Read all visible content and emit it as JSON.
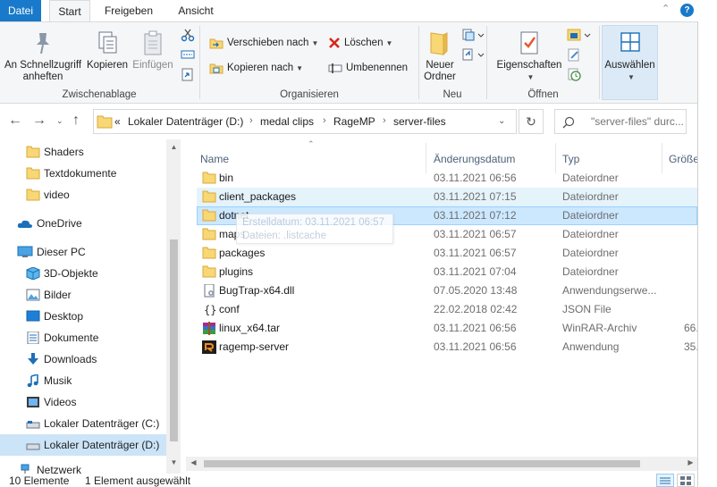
{
  "ribbon_tabs": {
    "file": "Datei",
    "start": "Start",
    "share": "Freigeben",
    "view": "Ansicht"
  },
  "help_label": "?",
  "clipboard": {
    "pin_label_1": "An Schnellzugriff",
    "pin_label_2": "anheften",
    "copy_label": "Kopieren",
    "paste_label": "Einfügen",
    "group_label": "Zwischenablage"
  },
  "organize": {
    "move_label": "Verschieben nach",
    "copy_to_label": "Kopieren nach",
    "delete_label": "Löschen",
    "rename_label": "Umbenennen",
    "group_label": "Organisieren"
  },
  "new": {
    "new_folder_label_1": "Neuer",
    "new_folder_label_2": "Ordner",
    "group_label": "Neu"
  },
  "open": {
    "properties_label": "Eigenschaften",
    "group_label": "Öffnen"
  },
  "select": {
    "select_label": "Auswählen"
  },
  "address": {
    "overflow": "«",
    "crumbs": [
      "Lokaler Datenträger (D:)",
      "medal clips",
      "RageMP",
      "server-files"
    ]
  },
  "search": {
    "placeholder": "\"server-files\" durc..."
  },
  "navigation": [
    {
      "label": "Shaders",
      "icon": "folder-icon"
    },
    {
      "label": "Textdokumente",
      "icon": "folder-icon"
    },
    {
      "label": "video",
      "icon": "folder-icon"
    },
    {
      "label": "OneDrive",
      "icon": "cloud-icon"
    },
    {
      "label": "Dieser PC",
      "icon": "computer-icon"
    },
    {
      "label": "3D-Objekte",
      "icon": "cube-icon"
    },
    {
      "label": "Bilder",
      "icon": "pictures-icon"
    },
    {
      "label": "Desktop",
      "icon": "desktop-icon"
    },
    {
      "label": "Dokumente",
      "icon": "documents-icon"
    },
    {
      "label": "Downloads",
      "icon": "download-icon"
    },
    {
      "label": "Musik",
      "icon": "music-icon"
    },
    {
      "label": "Videos",
      "icon": "videos-icon"
    },
    {
      "label": "Lokaler Datenträger (C:)",
      "icon": "drive-icon"
    },
    {
      "label": "Lokaler Datenträger (D:)",
      "icon": "drive-icon"
    },
    {
      "label": "Netzwerk",
      "icon": "network-icon"
    }
  ],
  "columns": {
    "name": "Name",
    "date": "Änderungsdatum",
    "type": "Typ",
    "size": "Größe"
  },
  "files": [
    {
      "name": "bin",
      "date": "03.11.2021 06:56",
      "type": "Dateiordner",
      "size": "",
      "icon": "folder-icon"
    },
    {
      "name": "client_packages",
      "date": "03.11.2021 07:15",
      "type": "Dateiordner",
      "size": "",
      "icon": "folder-icon"
    },
    {
      "name": "dotnet",
      "date": "03.11.2021 07:12",
      "type": "Dateiordner",
      "size": "",
      "icon": "folder-icon"
    },
    {
      "name": "maps",
      "date": "03.11.2021 06:57",
      "type": "Dateiordner",
      "size": "",
      "icon": "folder-icon"
    },
    {
      "name": "packages",
      "date": "03.11.2021 06:57",
      "type": "Dateiordner",
      "size": "",
      "icon": "folder-icon"
    },
    {
      "name": "plugins",
      "date": "03.11.2021 07:04",
      "type": "Dateiordner",
      "size": "",
      "icon": "folder-icon"
    },
    {
      "name": "BugTrap-x64.dll",
      "date": "07.05.2020 13:48",
      "type": "Anwendungserwe...",
      "size": "",
      "icon": "dll-file-icon"
    },
    {
      "name": "conf",
      "date": "22.02.2018 02:42",
      "type": "JSON File",
      "size": "",
      "icon": "json-file-icon"
    },
    {
      "name": "linux_x64.tar",
      "date": "03.11.2021 06:56",
      "type": "WinRAR-Archiv",
      "size": "66.",
      "icon": "winrar-archive-icon"
    },
    {
      "name": "ragemp-server",
      "date": "03.11.2021 06:56",
      "type": "Anwendung",
      "size": "35.",
      "icon": "app-icon"
    }
  ],
  "tooltip": {
    "line1": "Erstelldatum: 03.11.2021 06:57",
    "line2": "Dateien: .listcache"
  },
  "status": {
    "count": "10 Elemente",
    "selection": "1 Element ausgewählt"
  },
  "colors": {
    "accent": "#1979ca",
    "folder": "#f8d775",
    "selection": "#cce8ff",
    "hover": "#e5f3fb",
    "delete_red": "#d9251d"
  }
}
